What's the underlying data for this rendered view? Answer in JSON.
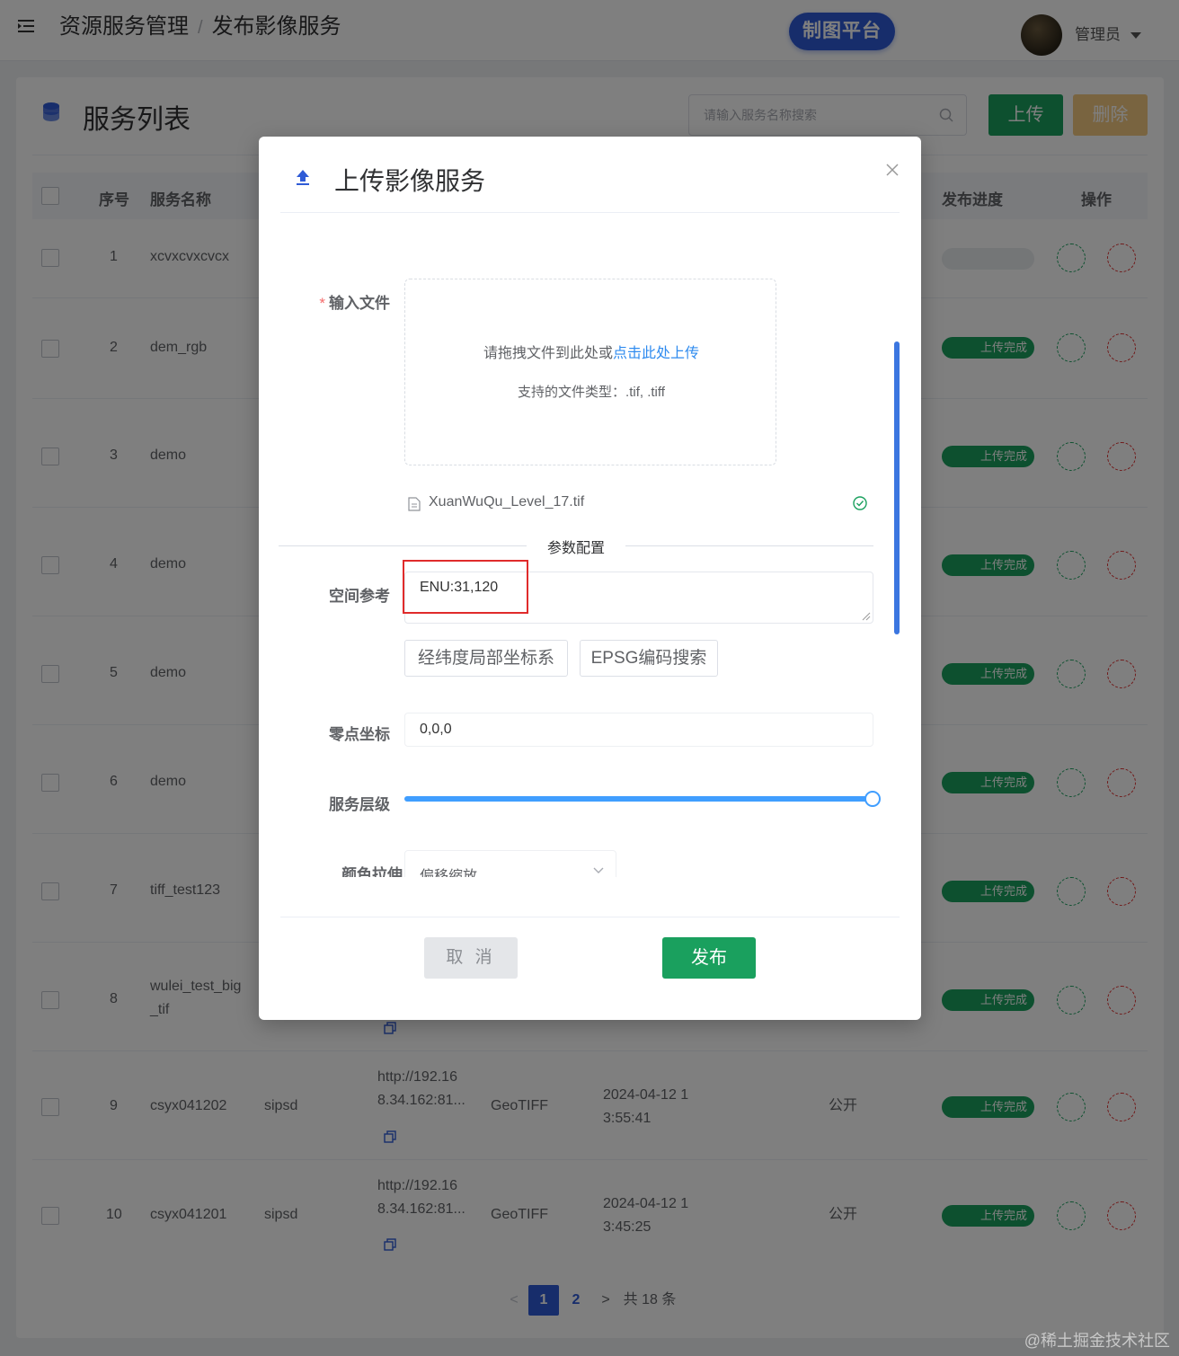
{
  "header": {
    "breadcrumb": [
      "资源服务管理",
      "发布影像服务"
    ],
    "breadcrumb_sep": "/",
    "platform_button": "制图平台",
    "user_name": "管理员"
  },
  "list": {
    "title": "服务列表",
    "search_placeholder": "请输入服务名称搜索",
    "upload_button": "上传",
    "delete_button": "删除",
    "columns": {
      "index": "序号",
      "name": "服务名称",
      "progress": "发布进度",
      "actions": "操作"
    },
    "rows": [
      {
        "index": "1",
        "name": "xcvxcvxcvcx",
        "status": ""
      },
      {
        "index": "2",
        "name": "dem_rgb",
        "status": "上传完成"
      },
      {
        "index": "3",
        "name": "demo",
        "status": "上传完成"
      },
      {
        "index": "4",
        "name": "demo",
        "status": "上传完成"
      },
      {
        "index": "5",
        "name": "demo",
        "status": "上传完成"
      },
      {
        "index": "6",
        "name": "demo",
        "status": "上传完成"
      },
      {
        "index": "7",
        "name": "tiff_test123",
        "status": "上传完成"
      },
      {
        "index": "8",
        "name": "wulei_test_big_tif",
        "status": "上传完成"
      },
      {
        "index": "9",
        "name": "csyx041202",
        "owner": "sipsd",
        "url": "http://192.168.34.162:81...",
        "format": "GeoTIFF",
        "time": "2024-04-12 13:55:41",
        "visibility": "公开",
        "status": "上传完成"
      },
      {
        "index": "10",
        "name": "csyx041201",
        "owner": "sipsd",
        "url": "http://192.168.34.162:81...",
        "format": "GeoTIFF",
        "time": "2024-04-12 13:45:25",
        "visibility": "公开",
        "status": "上传完成"
      }
    ],
    "row9_url_1": "http://192.16",
    "row9_url_2": "8.34.162:81...",
    "row9_time_1": "2024-04-12 1",
    "row9_time_2": "3:55:41",
    "row10_url_1": "http://192.16",
    "row10_url_2": "8.34.162:81...",
    "row10_time_1": "2024-04-12 1",
    "row10_time_2": "3:45:25",
    "row8_name_1": "wulei_test_big",
    "row8_name_2": "_tif"
  },
  "pagination": {
    "prev": "<",
    "pages": [
      "1",
      "2"
    ],
    "current_page": 1,
    "next": ">",
    "total": "共 18 条"
  },
  "modal": {
    "title": "上传影像服务",
    "file_label": "输入文件",
    "required_mark": "*",
    "drop_hint": "请拖拽文件到此处或",
    "drop_link": "点击此处上传",
    "file_types": "支持的文件类型：.tif, .tiff",
    "uploaded_file": "XuanWuQu_Level_17.tif",
    "section_title": "参数配置",
    "spatial_ref_label": "空间参考",
    "spatial_ref_value": "ENU:31,120",
    "btn_local_coord": "经纬度局部坐标系",
    "btn_epsg": "EPSG编码搜索",
    "origin_label": "零点坐标",
    "origin_value": "0,0,0",
    "level_label": "服务层级",
    "level_fraction": 1.0,
    "stretch_label": "颜色拉伸",
    "stretch_value": "偏移缩放",
    "cancel_button": "取 消",
    "publish_button": "发布"
  },
  "watermark": "@稀土掘金技术社区",
  "colors": {
    "primary_green": "#1aa05e",
    "brand_blue": "#2f5bd6",
    "link_blue": "#2f8bef",
    "danger_red": "#e02b2b",
    "slider_blue": "#409eff"
  }
}
